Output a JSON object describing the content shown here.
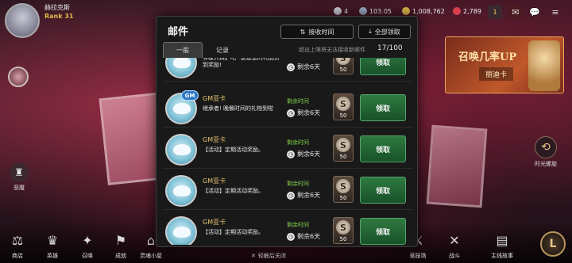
{
  "player": {
    "name": "赫拉克斯",
    "rank": "Rank 31"
  },
  "currencies": [
    {
      "value": "4",
      "color": "#c9c9d6"
    },
    {
      "value": "103.05",
      "color": "#9aa8c4"
    },
    {
      "value": "1,008,762",
      "color": "#e2b94a"
    },
    {
      "value": "2,789",
      "color": "#d9404f"
    }
  ],
  "top_icons": {
    "notice_badge": "1",
    "chat": "✉",
    "menu": "≡"
  },
  "mail": {
    "title": "邮件",
    "sort_button": "接收时间",
    "claim_all_button": "全部领取",
    "tabs": [
      "一般",
      "记录"
    ],
    "notice": "超出上限将无法接收新邮件",
    "count": "17/100",
    "rows": [
      {
        "sender": "",
        "body": "等级大赛】吧~这是您的礼品赞到奖励!",
        "remaining_label": "",
        "remaining": "剩余6天",
        "item_qty": "50",
        "claim": "领取",
        "gm": false
      },
      {
        "sender": "GM亚卡",
        "body": "继承者! 晚餐时间的礼物到啦",
        "remaining_label": "剩余时间",
        "remaining": "剩余6天",
        "item_qty": "50",
        "claim": "领取",
        "gm": true
      },
      {
        "sender": "GM亚卡",
        "body": "【活动】定期活动奖励。",
        "remaining_label": "剩余时间",
        "remaining": "剩余6天",
        "item_qty": "50",
        "claim": "领取",
        "gm": false
      },
      {
        "sender": "GM亚卡",
        "body": "【活动】定期活动奖励。",
        "remaining_label": "剩余时间",
        "remaining": "剩余6天",
        "item_qty": "50",
        "claim": "领取",
        "gm": false
      },
      {
        "sender": "GM亚卡",
        "body": "【活动】定期活动奖励。",
        "remaining_label": "剩余时间",
        "remaining": "剩余6天",
        "item_qty": "50",
        "claim": "领取",
        "gm": false
      }
    ]
  },
  "promo": {
    "title": "召唤几率UP",
    "subtitle": "丽迪卡"
  },
  "side": {
    "left_label": "恶魔",
    "right_label": "时光螺旋"
  },
  "bottom_nav": [
    "商店",
    "英雄",
    "召唤",
    "成就",
    "灵魂小屋",
    "轻松",
    "",
    "",
    "",
    "竞技场",
    "战斗",
    "主线故事",
    "冒险"
  ],
  "tap_close": "轻触后关闭"
}
